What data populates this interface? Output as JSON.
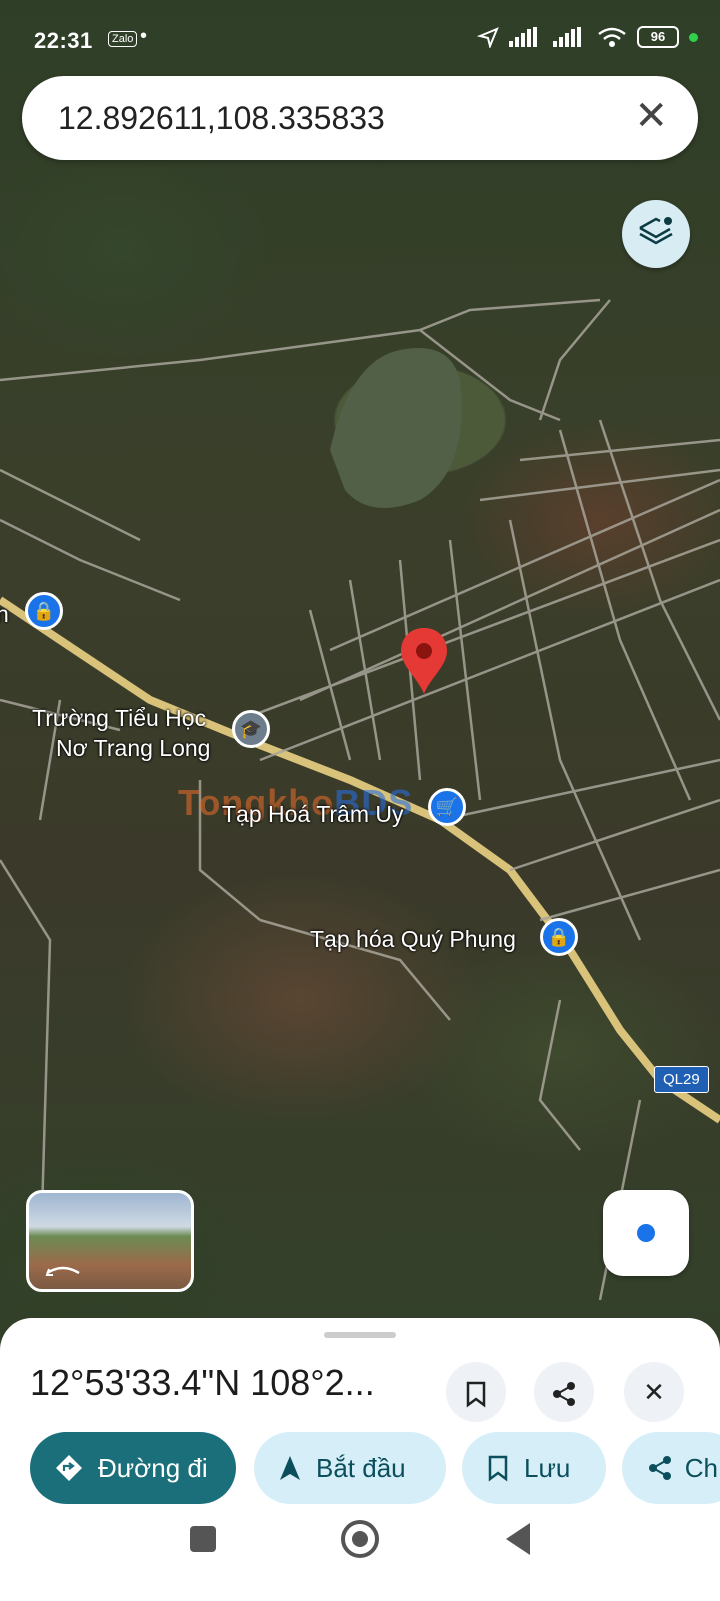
{
  "status_bar": {
    "time": "22:31",
    "app_icon": "Zalo",
    "dot": "•",
    "battery": "96"
  },
  "search": {
    "value": "12.892611,108.335833",
    "close_icon": "close-icon"
  },
  "map": {
    "labels": {
      "school": [
        "Trường Tiểu Học",
        "Nơ Trang Long"
      ],
      "shop_left": "n",
      "shop1": "Tạp Hoá Trâm Uy",
      "shop2": "Tạp hóa Quý Phụng",
      "road_shield": "QL29"
    },
    "watermark": {
      "part1": "Tongkho",
      "part2": "BDS"
    }
  },
  "sheet": {
    "coords": "12°53'33.4\"N 108°2...",
    "buttons": {
      "directions": "Đường đi",
      "start": "Bắt đầu",
      "save": "Lưu",
      "share": "Ch"
    }
  },
  "colors": {
    "primary": "#1b6f7a",
    "chip": "#d6eef8",
    "pin": "#e53935",
    "poi": "#1a73e8"
  }
}
